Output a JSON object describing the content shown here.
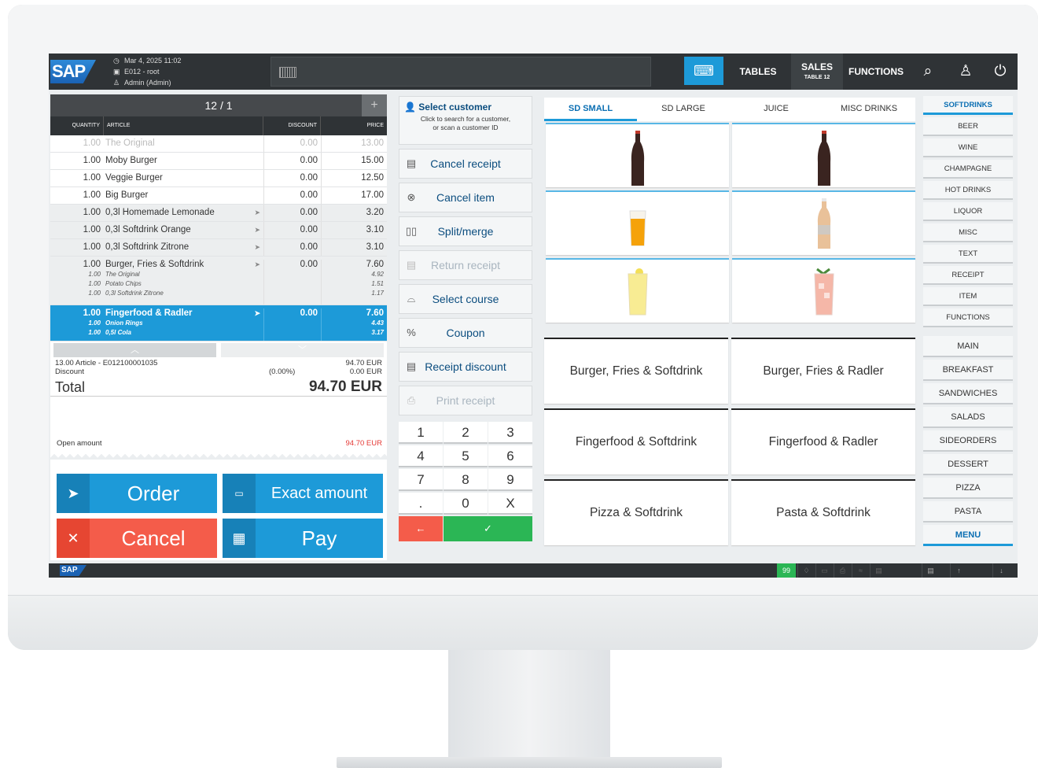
{
  "header": {
    "logo": "SAP",
    "datetime": "Mar 4, 2025 11:02",
    "terminal": "E012 - root",
    "user": "Admin (Admin)",
    "nav": {
      "tables": "TABLES",
      "sales": "SALES",
      "sales_sub": "TABLE 12",
      "functions": "FUNCTIONS"
    },
    "icons": [
      "keyboard-icon",
      "search-icon",
      "user-icon",
      "power-icon"
    ]
  },
  "order": {
    "title": "12 / 1",
    "add_label": "+",
    "columns": {
      "quantity": "QUANTITY",
      "article": "ARTICLE",
      "discount": "DISCOUNT",
      "price": "PRICE"
    },
    "rows": [
      {
        "qty": "1.00",
        "article": "The Original",
        "discount": "0.00",
        "price": "13.00"
      },
      {
        "qty": "1.00",
        "article": "Moby Burger",
        "discount": "0.00",
        "price": "15.00"
      },
      {
        "qty": "1.00",
        "article": "Veggie Burger",
        "discount": "0.00",
        "price": "12.50"
      },
      {
        "qty": "1.00",
        "article": "Big Burger",
        "discount": "0.00",
        "price": "17.00"
      },
      {
        "qty": "1.00",
        "article": "0,3l Homemade Lemonade",
        "discount": "0.00",
        "price": "3.20"
      },
      {
        "qty": "1.00",
        "article": "0,3l Softdrink Orange",
        "discount": "0.00",
        "price": "3.10"
      },
      {
        "qty": "1.00",
        "article": "0,3l Softdrink Zitrone",
        "discount": "0.00",
        "price": "3.10"
      }
    ],
    "menu_row": {
      "qty": "1.00",
      "article": "Burger, Fries & Softdrink",
      "discount": "0.00",
      "price": "7.60",
      "subs": [
        {
          "qty": "1.00",
          "article": "The Original",
          "price": "4.92"
        },
        {
          "qty": "1.00",
          "article": "Potato Chips",
          "price": "1.51"
        },
        {
          "qty": "1.00",
          "article": "0,3l Softdrink Zitrone",
          "price": "1.17"
        }
      ]
    },
    "selected_row": {
      "qty": "1.00",
      "article": "Fingerfood & Radler",
      "discount": "0.00",
      "price": "7.60",
      "subs": [
        {
          "qty": "1.00",
          "article": "Onion Rings",
          "price": "4.43"
        },
        {
          "qty": "1.00",
          "article": "0,5l Cola",
          "price": "3.17"
        }
      ]
    },
    "summary_articles": "13.00 Article - E012100001035",
    "summary_articles_amount": "94.70 EUR",
    "summary_discount_label": "Discount",
    "summary_discount_pct": "(0.00%)",
    "summary_discount_amount": "0.00 EUR",
    "total_label": "Total",
    "total_amount": "94.70 EUR",
    "open_amount_label": "Open amount",
    "open_amount": "94.70 EUR"
  },
  "actions": {
    "order": "Order",
    "exact": "Exact amount",
    "cancel": "Cancel",
    "pay": "Pay"
  },
  "functions": {
    "customer_title": "Select customer",
    "customer_sub1": "Click to search for a customer,",
    "customer_sub2": "or scan a customer ID",
    "cancel_receipt": "Cancel receipt",
    "cancel_item": "Cancel item",
    "split_merge": "Split/merge",
    "return_receipt": "Return receipt",
    "select_course": "Select course",
    "coupon": "Coupon",
    "receipt_discount": "Receipt discount",
    "print_receipt": "Print receipt"
  },
  "numpad": [
    "1",
    "2",
    "3",
    "4",
    "5",
    "6",
    "7",
    "8",
    "9",
    ".",
    "0",
    "X"
  ],
  "numpad_back": "←",
  "numpad_ok": "✓",
  "tabs": [
    "SD SMALL",
    "SD LARGE",
    "JUICE",
    "MISC DRINKS"
  ],
  "combos": [
    "Burger, Fries & Softdrink",
    "Burger, Fries & Radler",
    "Fingerfood & Softdrink",
    "Fingerfood & Radler",
    "Pizza & Softdrink",
    "Pasta & Softdrink"
  ],
  "categories_top": [
    "SOFTDRINKS",
    "BEER",
    "WINE",
    "CHAMPAGNE",
    "HOT DRINKS",
    "LIQUOR",
    "MISC",
    "TEXT",
    "RECEIPT",
    "ITEM",
    "FUNCTIONS"
  ],
  "categories_bottom": [
    "MAIN",
    "BREAKFAST",
    "SANDWICHES",
    "SALADS",
    "SIDEORDERS",
    "DESSERT",
    "PIZZA",
    "PASTA",
    "MENU"
  ],
  "status": {
    "logo": "SAP",
    "count": "99"
  },
  "colors": {
    "accent": "#1d9ad8",
    "danger": "#f45c4a",
    "success": "#2bb655",
    "header": "#2f3336"
  }
}
